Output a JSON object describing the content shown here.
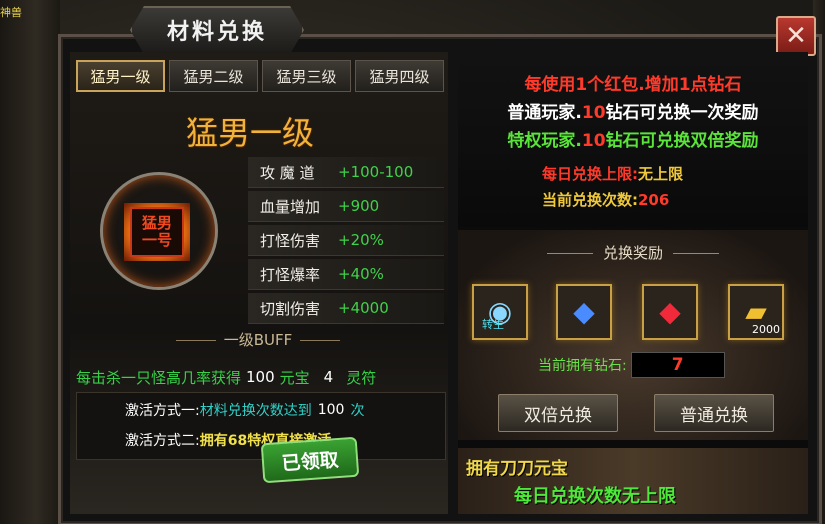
{
  "corner_tag": "神兽",
  "window_title": "材料兑换",
  "close_symbol": "✕",
  "tabs": [
    "猛男一级",
    "猛男二级",
    "猛男三级",
    "猛男四级"
  ],
  "level_title": "猛男一级",
  "emblem_text": "猛男一号",
  "stats": [
    {
      "k": "攻 魔 道",
      "v": "+100-100"
    },
    {
      "k": "血量增加",
      "v": "+900"
    },
    {
      "k": "打怪伤害",
      "v": "+20%"
    },
    {
      "k": "打怪爆率",
      "v": "+40%"
    },
    {
      "k": "切割伤害",
      "v": "+4000"
    }
  ],
  "buff": {
    "title": "一级BUFF",
    "line_a": "每击杀一只怪高几率获得",
    "n1": "100",
    "line_b": "元宝",
    "n2": "4",
    "line_c": "灵符"
  },
  "activation": {
    "way1_label": "激活方式一:",
    "way1_text": "材料兑换次数达到",
    "way1_num": "100",
    "way1_unit": "次",
    "way2_label": "激活方式二:",
    "way2_text": "拥有68特权直接激活"
  },
  "claimed_label": "已领取",
  "info": {
    "line1": "每使用1个红包.增加1点钻石",
    "line2_a": "普通玩家.",
    "line2_n": "10",
    "line2_b": "钻石可兑换一次奖励",
    "line3_a": "特权玩家.",
    "line3_n": "10",
    "line3_b": "钻石可兑换双倍奖励",
    "limit_label": "每日兑换上限:",
    "limit_value": "无上限",
    "count_label": "当前兑换次数:",
    "count_value": "206"
  },
  "rewards": {
    "title": "兑换奖励",
    "items": [
      {
        "icon": "rebirth-orb-icon",
        "glyph": "◉",
        "tag": "转生",
        "count": ""
      },
      {
        "icon": "blue-crystal-icon",
        "glyph": "◆",
        "tag": "",
        "count": ""
      },
      {
        "icon": "red-crystal-icon",
        "glyph": "◆",
        "tag": "",
        "count": ""
      },
      {
        "icon": "gold-ingot-icon",
        "glyph": "▰",
        "tag": "",
        "count": "2000"
      }
    ]
  },
  "diamonds_label": "当前拥有钻石:",
  "diamonds_value": "7",
  "buttons": {
    "double": "双倍兑换",
    "normal": "普通兑换"
  },
  "banner": {
    "line1": "拥有刀刀元宝",
    "line2": "每日兑换次数无上限"
  },
  "colors": {
    "accent_gold": "#c9a046",
    "green": "#3fd24a",
    "red": "#ff3a2a",
    "yellow": "#f0c93a"
  }
}
